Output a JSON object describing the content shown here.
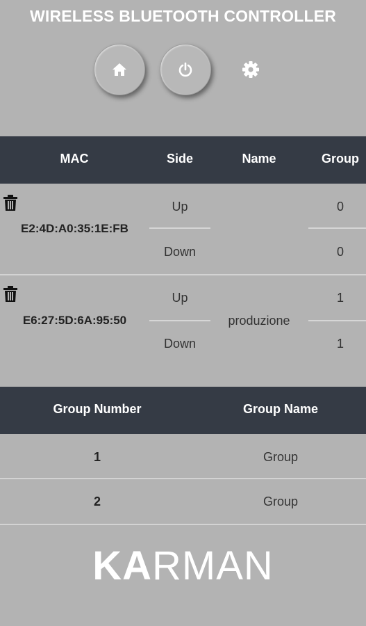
{
  "app": {
    "title": "WIRELESS BLUETOOTH CONTROLLER"
  },
  "toolbar": {
    "home_icon": "home-icon",
    "power_icon": "power-icon",
    "settings_icon": "gear-icon"
  },
  "devices_table": {
    "headers": [
      "MAC",
      "Side",
      "Name",
      "Group"
    ],
    "rows": [
      {
        "mac": "E2:4D:A0:35:1E:FB",
        "name": "",
        "up_label": "Up",
        "down_label": "Down",
        "up_group": "0",
        "down_group": "0"
      },
      {
        "mac": "E6:27:5D:6A:95:50",
        "name": "produzione",
        "up_label": "Up",
        "down_label": "Down",
        "up_group": "1",
        "down_group": "1"
      }
    ]
  },
  "groups_table": {
    "headers": [
      "Group Number",
      "Group Name"
    ],
    "rows": [
      {
        "number": "1",
        "name": "Group"
      },
      {
        "number": "2",
        "name": "Group"
      }
    ]
  },
  "brand": {
    "logo_bold": "KA",
    "logo_light": "RMAN"
  }
}
